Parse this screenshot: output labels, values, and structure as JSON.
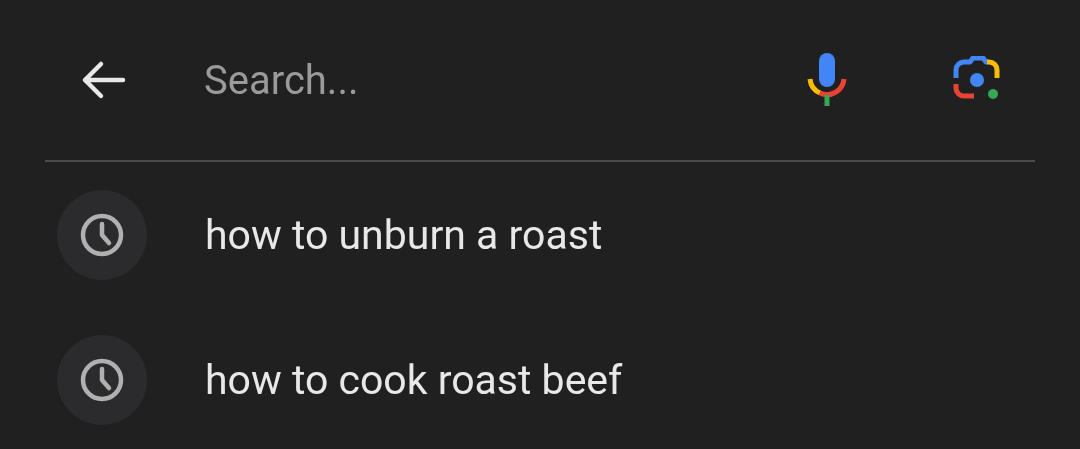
{
  "search": {
    "placeholder": "Search..."
  },
  "suggestions": [
    {
      "text": "how to unburn a roast",
      "kind": "history"
    },
    {
      "text": "how to cook roast beef",
      "kind": "history"
    }
  ]
}
